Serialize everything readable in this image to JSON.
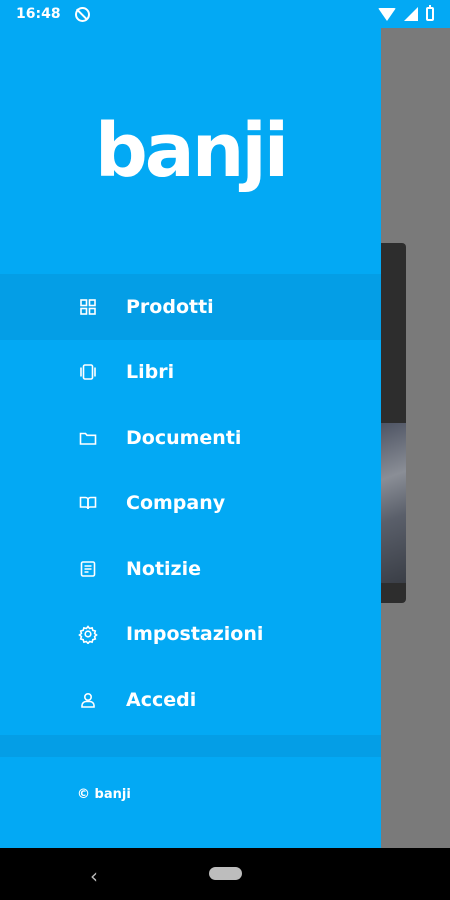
{
  "status_bar": {
    "time": "16:48",
    "icons": [
      "do-not-disturb-icon",
      "wifi-icon",
      "signal-icon",
      "battery-icon"
    ]
  },
  "drawer": {
    "logo_text": "banji",
    "menu_items": [
      {
        "label": "Prodotti",
        "icon": "grid-icon",
        "active": true
      },
      {
        "label": "Libri",
        "icon": "carousel-icon",
        "active": false
      },
      {
        "label": "Documenti",
        "icon": "folder-icon",
        "active": false
      },
      {
        "label": "Company",
        "icon": "book-open-icon",
        "active": false
      },
      {
        "label": "Notizie",
        "icon": "news-icon",
        "active": false
      },
      {
        "label": "Impostazioni",
        "icon": "gear-icon",
        "active": false
      },
      {
        "label": "Accedi",
        "icon": "user-icon",
        "active": false
      }
    ],
    "copyright": "© banji"
  },
  "navigation_bar": {
    "back": "‹"
  },
  "colors": {
    "drawer_bg": "#03a9f4",
    "active_item_bg": "#049ee6",
    "text": "#ffffff"
  }
}
